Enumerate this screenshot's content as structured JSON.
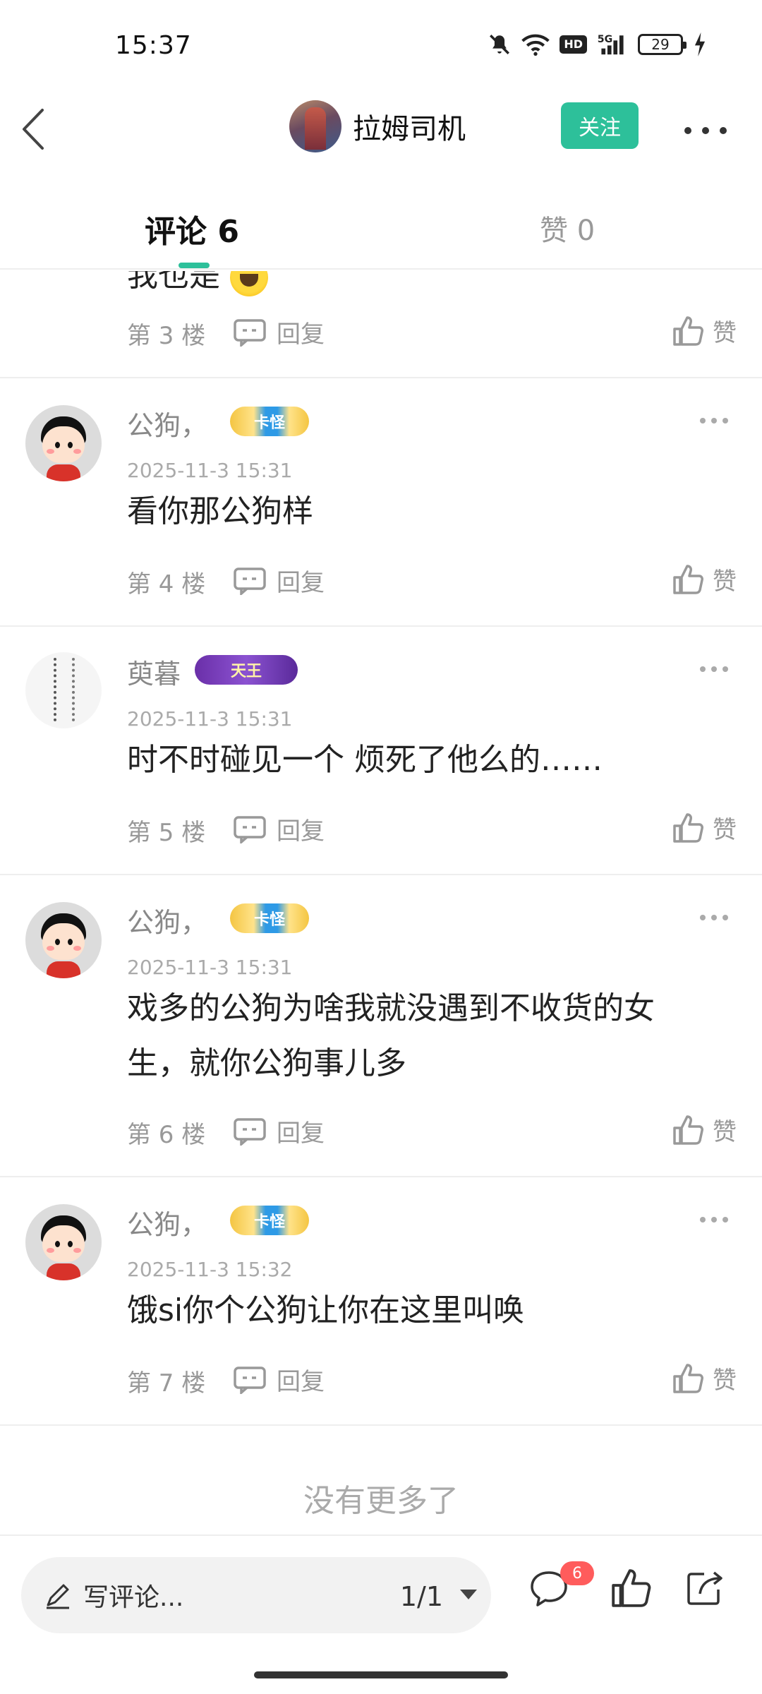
{
  "status_bar": {
    "time": "15:37",
    "battery": "29"
  },
  "header": {
    "author_name": "拉姆司机",
    "follow_label": "关注"
  },
  "tabs": {
    "comments": "评论 6",
    "likes": "赞 0"
  },
  "partial_comment": {
    "text": "我也是"
  },
  "comments": [
    {
      "floor": "第 3 楼",
      "reply": "回复",
      "like": "赞"
    },
    {
      "user": "公狗，",
      "badge": "卡怪",
      "time": "2025-11-3 15:31",
      "text": "看你那公狗样",
      "floor": "第 4 楼",
      "reply": "回复",
      "like": "赞"
    },
    {
      "user": "萸暮",
      "badge": "天王",
      "time": "2025-11-3 15:31",
      "text": "时不时碰见一个 烦死了他么的……",
      "floor": "第 5 楼",
      "reply": "回复",
      "like": "赞"
    },
    {
      "user": "公狗，",
      "badge": "卡怪",
      "time": "2025-11-3 15:31",
      "text": "戏多的公狗为啥我就没遇到不收货的女生，就你公狗事儿多",
      "floor": "第 6 楼",
      "reply": "回复",
      "like": "赞"
    },
    {
      "user": "公狗，",
      "badge": "卡怪",
      "time": "2025-11-3 15:32",
      "text": "饿si你个公狗让你在这里叫唤",
      "floor": "第 7 楼",
      "reply": "回复",
      "like": "赞"
    }
  ],
  "footer": {
    "no_more": "没有更多了"
  },
  "bottom_bar": {
    "write_placeholder": "写评论...",
    "page": "1/1",
    "comment_count": "6"
  },
  "colors": {
    "accent": "#2dc09a",
    "badge_red": "#ff5c5c"
  }
}
